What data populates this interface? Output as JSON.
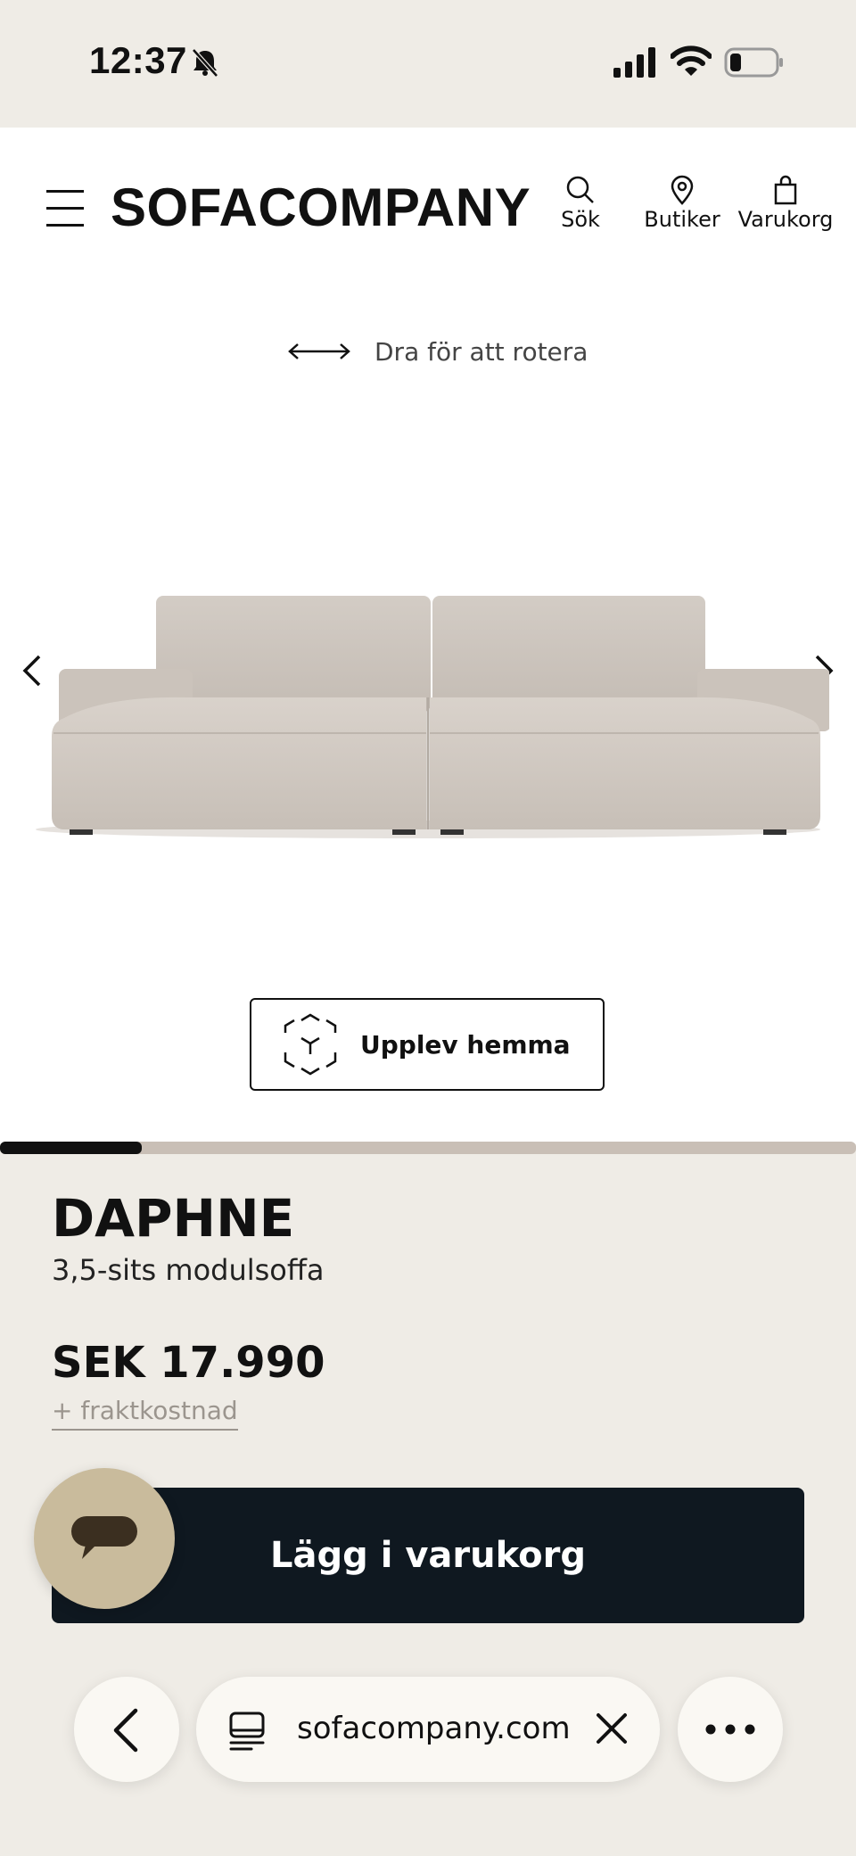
{
  "status_bar": {
    "time": "12:37"
  },
  "header": {
    "logo": "SOFACOMPANY",
    "nav": {
      "search": "Sök",
      "stores": "Butiker",
      "cart": "Varukorg"
    }
  },
  "viewer": {
    "rotate_hint": "Dra för att rotera",
    "ar_button": "Upplev hemma",
    "gallery_progress": 0.166
  },
  "product": {
    "name": "DAPHNE",
    "subtitle": "3,5-sits modulsoffa",
    "price": "SEK 17.990",
    "shipping": "+ fraktkostnad",
    "add_to_cart": "Lägg i varukorg"
  },
  "browser": {
    "url": "sofacompany.com"
  },
  "colors": {
    "background": "#efece6",
    "button_dark": "#0f1820",
    "chat_bubble": "#c9bb9c",
    "sofa_fabric": "#cfc7bf"
  }
}
